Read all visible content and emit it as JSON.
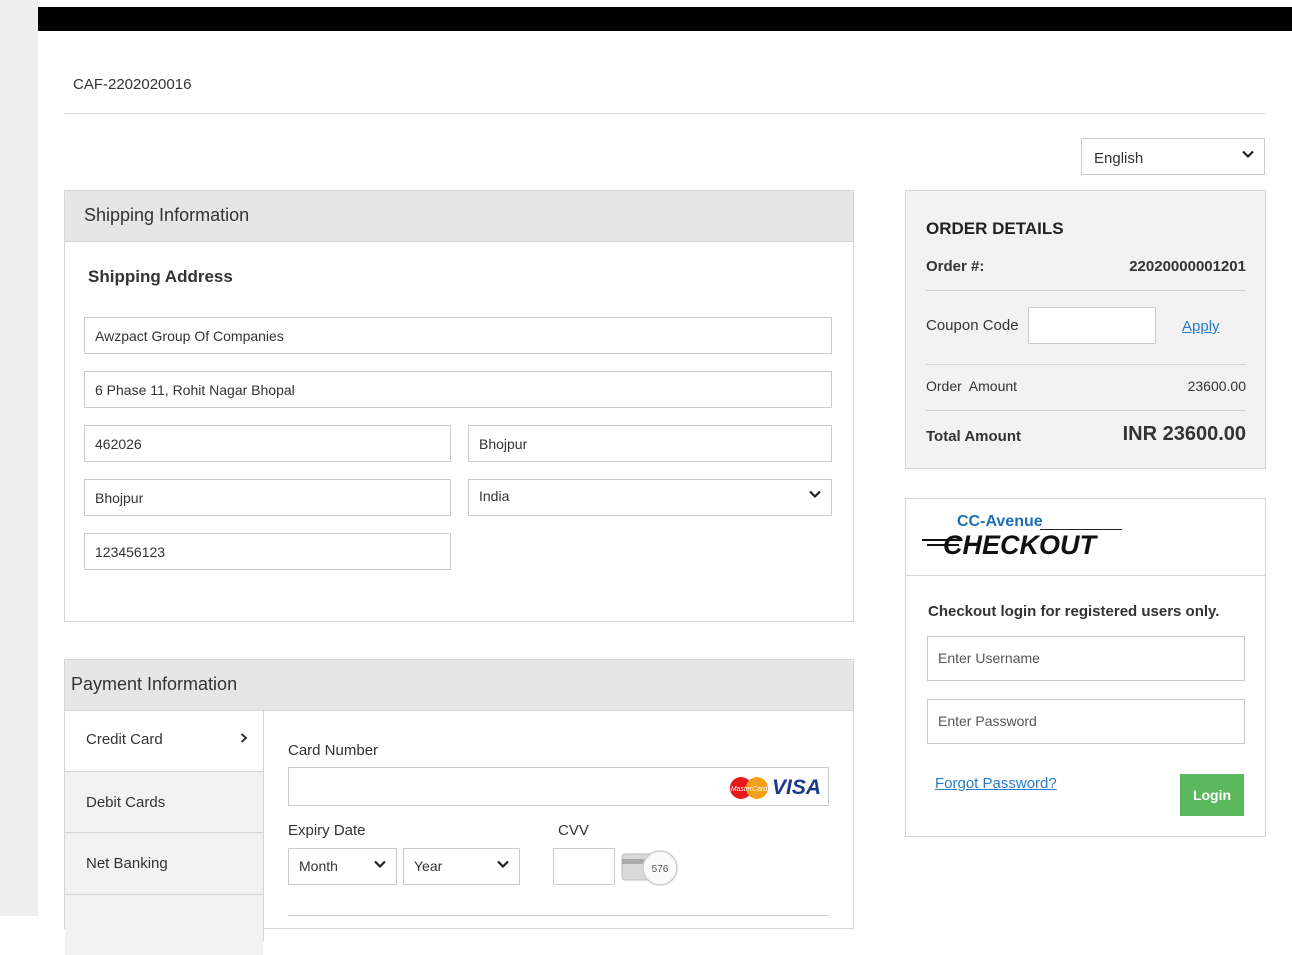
{
  "merchant_ref": "CAF-2202020016",
  "language": {
    "selected": "English"
  },
  "shipping": {
    "section_title": "Shipping Information",
    "subtitle": "Shipping Address",
    "name": "Awzpact Group Of Companies",
    "address": "6 Phase 11, Rohit Nagar Bhopal",
    "zip": "462026",
    "city": "Bhojpur",
    "state": "Bhojpur",
    "country": "India",
    "phone": "123456123"
  },
  "payment": {
    "section_title": "Payment Information",
    "tabs": [
      {
        "label": "Credit Card",
        "active": true
      },
      {
        "label": "Debit Cards",
        "active": false
      },
      {
        "label": "Net Banking",
        "active": false
      }
    ],
    "card_number_label": "Card Number",
    "card_brands": {
      "mastercard": "MasterCard",
      "visa": "VISA"
    },
    "expiry_label": "Expiry Date",
    "month_placeholder": "Month",
    "year_placeholder": "Year",
    "cvv_label": "CVV",
    "cvv_hint": "576"
  },
  "order": {
    "title": "ORDER DETAILS",
    "order_no_label": "Order #:",
    "order_no": "22020000001201",
    "coupon_label": "Coupon Code",
    "apply_label": "Apply",
    "amount_label": "Order  Amount",
    "amount": "23600.00",
    "total_label": "Total Amount",
    "total": "INR 23600.00"
  },
  "checkout": {
    "logo_top": "CC-Avenue",
    "logo_main": "CHECKOUT",
    "note": "Checkout login for registered users only.",
    "username_placeholder": "Enter Username",
    "password_placeholder": "Enter Password",
    "forgot_label": "Forgot Password?",
    "login_label": "Login"
  },
  "colors": {
    "accent_link": "#2a7ac7",
    "login_green": "#5cb85c",
    "logo_blue": "#1c6fb8"
  }
}
